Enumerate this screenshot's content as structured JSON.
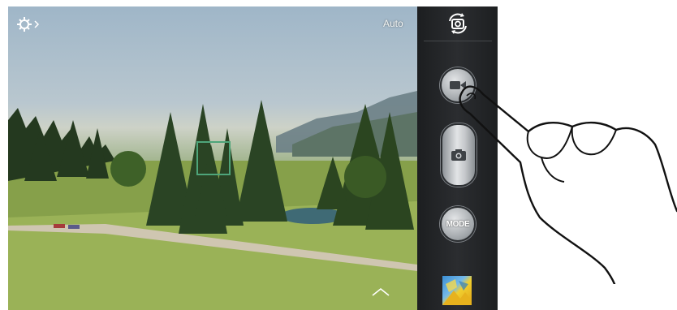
{
  "viewfinder": {
    "scene_icon": "landscape-scene",
    "settings_icon": "gear-icon",
    "flash_mode_label": "Auto",
    "expand_icon": "chevron-up-icon"
  },
  "side_panel": {
    "switch_camera_icon": "switch-camera-icon",
    "record_icon": "video-camera-icon",
    "shutter_icon": "camera-icon",
    "mode_label": "MODE",
    "gallery_icon": "gallery-thumbnail"
  },
  "overlay": {
    "hand_icon": "pointing-hand-icon"
  },
  "colors": {
    "panel_bg": "#2b2d30",
    "focus_box": "#4ea57a"
  }
}
